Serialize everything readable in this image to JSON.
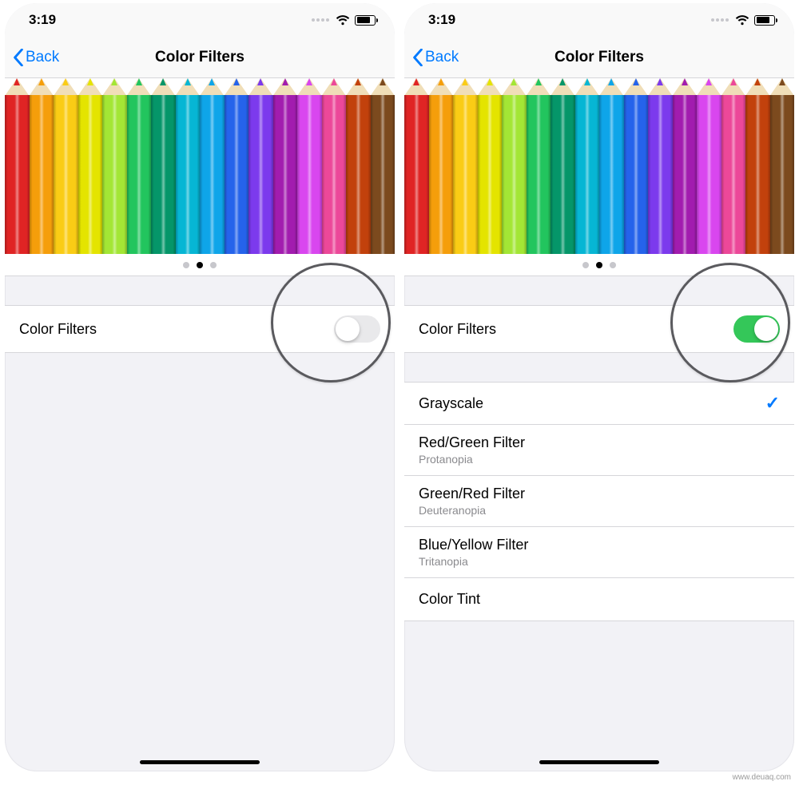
{
  "status": {
    "time": "3:19"
  },
  "nav": {
    "back": "Back",
    "title": "Color Filters"
  },
  "pencil_colors": [
    "#e02424",
    "#f59e0b",
    "#facc15",
    "#e4e400",
    "#a3e635",
    "#22c55e",
    "#059669",
    "#06b6d4",
    "#0ea5e9",
    "#2563eb",
    "#7c3aed",
    "#a21caf",
    "#d946ef",
    "#ec4899",
    "#c2410c",
    "#7c4a1e"
  ],
  "page_indicator": {
    "count": 3,
    "active": 1
  },
  "left": {
    "toggle_label": "Color Filters",
    "toggle_on": false
  },
  "right": {
    "toggle_label": "Color Filters",
    "toggle_on": true,
    "options": [
      {
        "label": "Grayscale",
        "sub": "",
        "selected": true
      },
      {
        "label": "Red/Green Filter",
        "sub": "Protanopia",
        "selected": false
      },
      {
        "label": "Green/Red Filter",
        "sub": "Deuteranopia",
        "selected": false
      },
      {
        "label": "Blue/Yellow Filter",
        "sub": "Tritanopia",
        "selected": false
      },
      {
        "label": "Color Tint",
        "sub": "",
        "selected": false
      }
    ]
  },
  "watermark": "www.deuaq.com"
}
